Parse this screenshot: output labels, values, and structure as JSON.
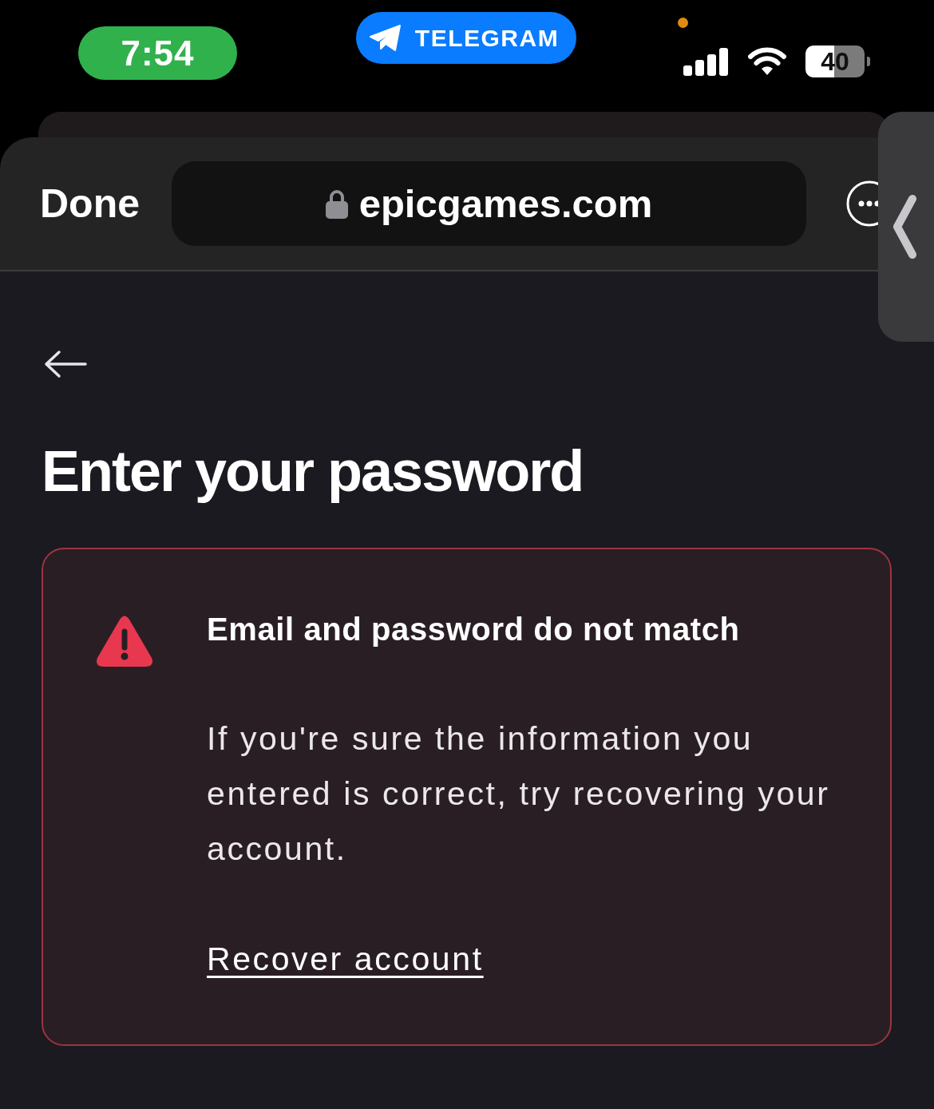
{
  "status_bar": {
    "time": "7:54",
    "app_pill": "TELEGRAM",
    "battery": "40"
  },
  "browser_toolbar": {
    "done_button": "Done",
    "address": "epicgames.com"
  },
  "page": {
    "heading": "Enter your password",
    "error_card": {
      "title": "Email and password do not match",
      "message": "If you're sure the information you entered is correct, try recovering your account.",
      "link": "Recover account"
    }
  }
}
